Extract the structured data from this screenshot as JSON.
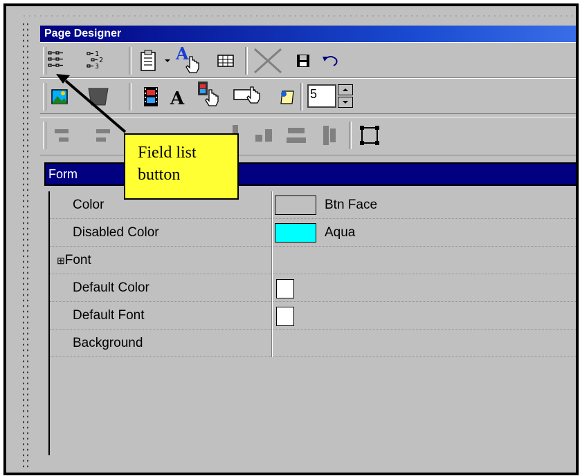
{
  "window": {
    "title": "Page Designer"
  },
  "toolbar1": {
    "icons": [
      "field-list-icon",
      "numbered-list-icon",
      "properties-icon",
      "dropdown-arrow-icon",
      "font-pointer-icon",
      "grid-icon",
      "delete-icon",
      "save-icon",
      "undo-icon"
    ]
  },
  "toolbar2": {
    "icons": [
      "image-icon",
      "frame-icon",
      "film-icon",
      "text-icon",
      "select-pointer-icon",
      "button-pointer-icon",
      "note-icon"
    ],
    "spinner_value": "5"
  },
  "toolbar3": {
    "icons": [
      "align-left-icon",
      "align-right-icon",
      "align-center-icon",
      "align-text-icon",
      "space-horizontal-icon",
      "space-vertical-icon",
      "resize-icon"
    ]
  },
  "selector": {
    "value": "Form"
  },
  "properties": [
    {
      "name": "Color",
      "value": "Btn Face",
      "swatch": "#c0c0c0",
      "type": "color"
    },
    {
      "name": "Disabled Color",
      "value": "Aqua",
      "swatch": "#00ffff",
      "type": "color"
    },
    {
      "name": "Font",
      "value": "",
      "type": "expand",
      "expander": "⊞"
    },
    {
      "name": "Default Color",
      "value": "",
      "type": "box"
    },
    {
      "name": "Default Font",
      "value": "",
      "type": "box"
    },
    {
      "name": "Background",
      "value": "",
      "type": "none"
    }
  ],
  "callout": {
    "line1": "Field list",
    "line2": "button"
  },
  "colors": {
    "titlebar": "#000080",
    "callout": "#ffff33",
    "face": "#c0c0c0"
  }
}
